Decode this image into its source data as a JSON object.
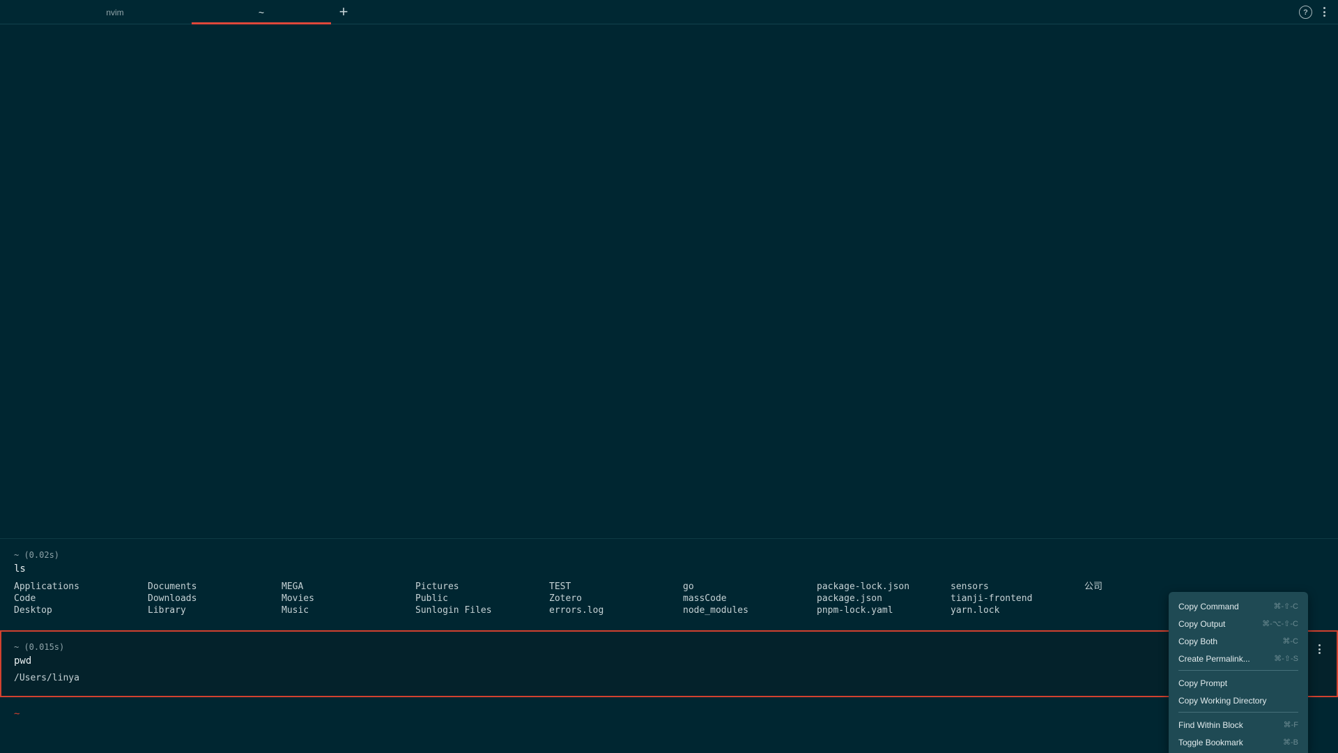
{
  "tabs": {
    "items": [
      {
        "label": "nvim"
      },
      {
        "label": "~"
      }
    ],
    "add_label": "+",
    "help_label": "?"
  },
  "icons": {
    "add": "plus-icon",
    "help": "help-circle-icon",
    "menu": "kebab-icon"
  },
  "colors": {
    "background": "#002631",
    "accent": "#e0473a",
    "menu_background": "#1f4a54"
  },
  "block1": {
    "header": "~ (0.02s)",
    "command": "ls",
    "output_columns": [
      [
        "Applications",
        "Code",
        "Desktop"
      ],
      [
        "Documents",
        "Downloads",
        "Library"
      ],
      [
        "MEGA",
        "Movies",
        "Music"
      ],
      [
        "Pictures",
        "Public",
        "Sunlogin Files"
      ],
      [
        "TEST",
        "Zotero",
        "errors.log"
      ],
      [
        "go",
        "massCode",
        "node_modules"
      ],
      [
        "package-lock.json",
        "package.json",
        "pnpm-lock.yaml"
      ],
      [
        "sensors",
        "tianji-frontend",
        "yarn.lock"
      ],
      [
        "公司"
      ]
    ]
  },
  "block2": {
    "header": "~ (0.015s)",
    "command": "pwd",
    "output": "/Users/linya"
  },
  "prompt": {
    "symbol": "~"
  },
  "context_menu": {
    "group1": [
      {
        "label": "Copy Command",
        "shortcut": "⌘-⇧-C"
      },
      {
        "label": "Copy Output",
        "shortcut": "⌘-⌥-⇧-C"
      },
      {
        "label": "Copy Both",
        "shortcut": "⌘-C"
      },
      {
        "label": "Create Permalink...",
        "shortcut": "⌘-⇧-S"
      }
    ],
    "group2": [
      {
        "label": "Copy Prompt",
        "shortcut": ""
      },
      {
        "label": "Copy Working Directory",
        "shortcut": ""
      }
    ],
    "group3": [
      {
        "label": "Find Within Block",
        "shortcut": "⌘-F"
      },
      {
        "label": "Toggle Bookmark",
        "shortcut": "⌘-B"
      }
    ]
  }
}
